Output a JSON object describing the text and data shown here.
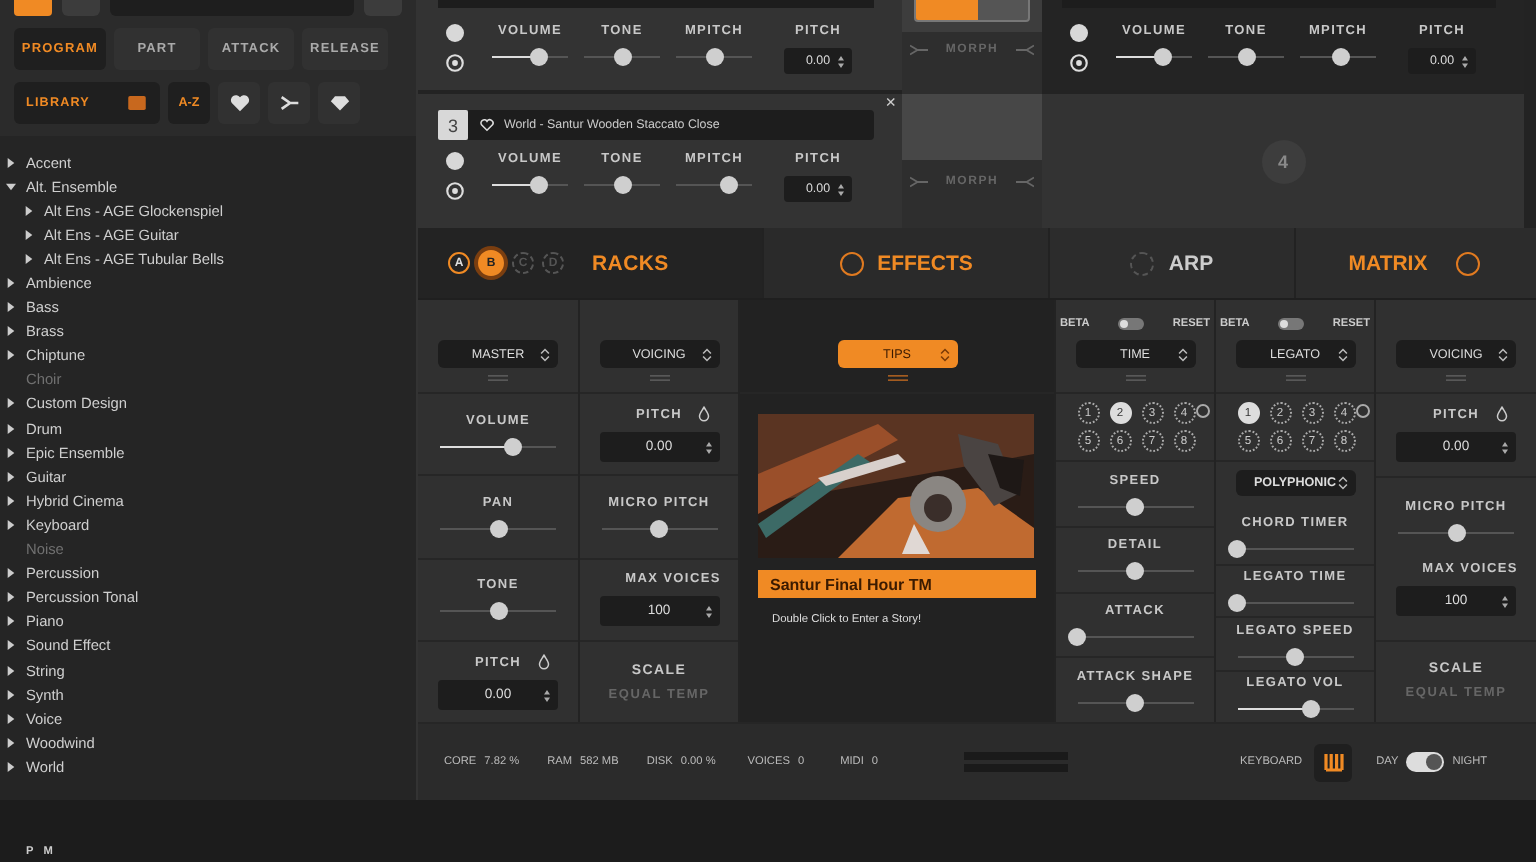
{
  "sidebar": {
    "mode_buttons": [
      {
        "label": "PROGRAM",
        "selected": true
      },
      {
        "label": "PART",
        "selected": false
      },
      {
        "label": "ATTACK",
        "selected": false
      },
      {
        "label": "RELEASE",
        "selected": false
      }
    ],
    "library": {
      "label": "LIBRARY"
    },
    "sort": {
      "label": "A-Z",
      "selected": true
    },
    "filters": [
      {
        "kind": "heart"
      },
      {
        "kind": "fork"
      },
      {
        "kind": "diamond"
      }
    ],
    "tree": [
      {
        "label": "Accent",
        "disabled": false,
        "expanded": false
      },
      {
        "label": "Alt. Ensemble",
        "disabled": false,
        "expanded": true,
        "children": [
          {
            "label": "Alt Ens - AGE Glockenspiel",
            "disabled": false,
            "expanded": false
          },
          {
            "label": "Alt Ens - AGE Guitar",
            "disabled": false,
            "expanded": false
          },
          {
            "label": "Alt Ens - AGE Tubular Bells",
            "disabled": false,
            "expanded": false
          }
        ]
      },
      {
        "label": "Ambience",
        "disabled": false,
        "expanded": false
      },
      {
        "label": "Bass",
        "disabled": false,
        "expanded": false
      },
      {
        "label": "Brass",
        "disabled": false,
        "expanded": false
      },
      {
        "label": "Chiptune",
        "disabled": false,
        "expanded": false
      },
      {
        "label": "Choir",
        "disabled": true,
        "expanded": false
      },
      {
        "label": "Custom Design",
        "disabled": false,
        "expanded": false
      },
      {
        "label": "Drum",
        "disabled": false,
        "expanded": false
      },
      {
        "label": "Epic Ensemble",
        "disabled": false,
        "expanded": false
      },
      {
        "label": "Guitar",
        "disabled": false,
        "expanded": false
      },
      {
        "label": "Hybrid Cinema",
        "disabled": false,
        "expanded": false
      },
      {
        "label": "Keyboard",
        "disabled": false,
        "expanded": false
      },
      {
        "label": "Noise",
        "disabled": true,
        "expanded": false
      },
      {
        "label": "Percussion",
        "disabled": false,
        "expanded": false
      },
      {
        "label": "Percussion Tonal",
        "disabled": false,
        "expanded": false
      },
      {
        "label": "Piano",
        "disabled": false,
        "expanded": false
      },
      {
        "label": "Sound Effect",
        "disabled": false,
        "expanded": false
      },
      {
        "label": "String",
        "disabled": false,
        "expanded": false
      },
      {
        "label": "Synth",
        "disabled": false,
        "expanded": false
      },
      {
        "label": "Voice",
        "disabled": false,
        "expanded": false
      },
      {
        "label": "Woodwind",
        "disabled": false,
        "expanded": false
      },
      {
        "label": "World",
        "disabled": false,
        "expanded": false
      }
    ],
    "footer": [
      "P",
      "M"
    ]
  },
  "racks": [
    {
      "kind": "rack",
      "sliders": [
        {
          "label": "VOLUME",
          "level": 0.63
        },
        {
          "label": "TONE",
          "level": 0.5
        },
        {
          "label": "MPITCH",
          "level": 0.5
        }
      ],
      "pitch": {
        "label": "PITCH",
        "value": "0.00"
      }
    },
    {
      "kind": "rack",
      "sliders": [
        {
          "label": "VOLUME",
          "level": 0.63
        },
        {
          "label": "TONE",
          "level": 0.5
        },
        {
          "label": "MPITCH",
          "level": 0.55
        }
      ],
      "pitch": {
        "label": "PITCH",
        "value": "0.00"
      }
    },
    {
      "kind": "rack",
      "slot": "3",
      "name": "World - Santur Wooden Staccato Close",
      "close": "×",
      "sliders": [
        {
          "label": "VOLUME",
          "level": 0.63
        },
        {
          "label": "TONE",
          "level": 0.5
        },
        {
          "label": "MPITCH",
          "level": 0.7
        }
      ],
      "pitch": {
        "label": "PITCH",
        "value": "0.00"
      }
    },
    {
      "kind": "empty",
      "slot": "4"
    }
  ],
  "morph": [
    {
      "label": "MORPH",
      "level": 0.55
    },
    {
      "label": "MORPH"
    }
  ],
  "rack_tabs": {
    "slots": [
      {
        "label": "A",
        "on": true,
        "selected": false
      },
      {
        "label": "B",
        "on": true,
        "selected": true
      },
      {
        "label": "C",
        "on": false,
        "selected": false
      },
      {
        "label": "D",
        "on": false,
        "selected": false
      }
    ],
    "title": "RACKS"
  },
  "sections": [
    {
      "label": "EFFECTS",
      "on": true,
      "circle_after": false
    },
    {
      "label": "ARP",
      "on": false,
      "circle_after": false
    },
    {
      "label": "MATRIX",
      "on": true,
      "circle_after": true
    }
  ],
  "panels": [
    {
      "kind": "controls",
      "dropdown": "MASTER",
      "cells": [
        [
          {
            "kind": "slider",
            "label": "VOLUME",
            "level": 0.63
          }
        ],
        [
          {
            "kind": "slider",
            "label": "PAN",
            "level": 0.5
          }
        ],
        [
          {
            "kind": "slider",
            "label": "TONE",
            "level": 0.5
          }
        ],
        [
          {
            "kind": "number",
            "label": "PITCH",
            "value": "0.00",
            "drop_icon": true
          }
        ]
      ]
    },
    {
      "kind": "controls",
      "dropdown": "VOICING",
      "cells": [
        [
          {
            "kind": "number",
            "label": "PITCH",
            "value": "0.00",
            "drop_icon": true
          }
        ],
        [
          {
            "kind": "slider",
            "label": "MICRO PITCH",
            "level": 0.5
          }
        ],
        [
          {
            "kind": "number",
            "label": "MAX VOICES",
            "value": "100"
          }
        ],
        [
          {
            "kind": "scale",
            "label": "SCALE",
            "value": "EQUAL TEMP"
          }
        ]
      ]
    },
    {
      "kind": "story",
      "dropdown": "TIPS",
      "title": "Santur Final Hour TM",
      "hint": "Double Click to Enter a Story!"
    },
    {
      "kind": "controls",
      "beta": "BETA",
      "reset": "RESET",
      "beta_on": false,
      "dropdown": "TIME",
      "steps": [
        {
          "label": "1",
          "selected": false
        },
        {
          "label": "2",
          "selected": true
        },
        {
          "label": "3",
          "selected": false
        },
        {
          "label": "4",
          "selected": false
        },
        {
          "label": "5",
          "selected": false
        },
        {
          "label": "6",
          "selected": false
        },
        {
          "label": "7",
          "selected": false
        },
        {
          "label": "8",
          "selected": false
        }
      ],
      "cells": [
        [
          {
            "kind": "slider",
            "label": "SPEED",
            "level": 0.5
          }
        ],
        [
          {
            "kind": "slider",
            "label": "DETAIL",
            "level": 0.5
          }
        ],
        [
          {
            "kind": "slider",
            "label": "ATTACK",
            "level": 0
          }
        ],
        [
          {
            "kind": "slider",
            "label": "ATTACK SHAPE",
            "level": 0.5
          }
        ]
      ]
    },
    {
      "kind": "controls",
      "beta": "BETA",
      "reset": "RESET",
      "beta_on": false,
      "dropdown": "LEGATO",
      "steps": [
        {
          "label": "1",
          "selected": true
        },
        {
          "label": "2",
          "selected": false
        },
        {
          "label": "3",
          "selected": false
        },
        {
          "label": "4",
          "selected": false
        },
        {
          "label": "5",
          "selected": false
        },
        {
          "label": "6",
          "selected": false
        },
        {
          "label": "7",
          "selected": false
        },
        {
          "label": "8",
          "selected": false
        }
      ],
      "cells": [
        [
          {
            "kind": "select",
            "value": "POLYPHONIC"
          },
          {
            "kind": "slider",
            "label": "CHORD TIMER",
            "level": 0
          }
        ],
        [
          {
            "kind": "slider",
            "label": "LEGATO TIME",
            "level": 0
          }
        ],
        [
          {
            "kind": "slider",
            "label": "LEGATO SPEED",
            "level": 0.5
          }
        ],
        [
          {
            "kind": "slider",
            "label": "LEGATO VOL",
            "level": 0.63
          }
        ]
      ]
    },
    {
      "kind": "controls",
      "dropdown": "VOICING",
      "cells": [
        [
          {
            "kind": "number",
            "label": "PITCH",
            "value": "0.00",
            "drop_icon": true
          }
        ],
        [
          {
            "kind": "slider",
            "label": "MICRO PITCH",
            "level": 0.5
          },
          {
            "kind": "number",
            "label": "MAX VOICES",
            "value": "100"
          }
        ],
        [
          {
            "kind": "scale",
            "label": "SCALE",
            "value": "EQUAL TEMP"
          }
        ]
      ]
    }
  ],
  "status": [
    {
      "label": "CORE",
      "value": "7.82 %"
    },
    {
      "label": "RAM",
      "value": "582 MB"
    },
    {
      "label": "DISK",
      "value": "0.00 %"
    },
    {
      "label": "VOICES",
      "value": "0"
    },
    {
      "label": "MIDI",
      "value": "0"
    }
  ],
  "keyboard": {
    "label": "KEYBOARD"
  },
  "theme": {
    "day": "DAY",
    "night": "NIGHT",
    "night_on": true
  }
}
